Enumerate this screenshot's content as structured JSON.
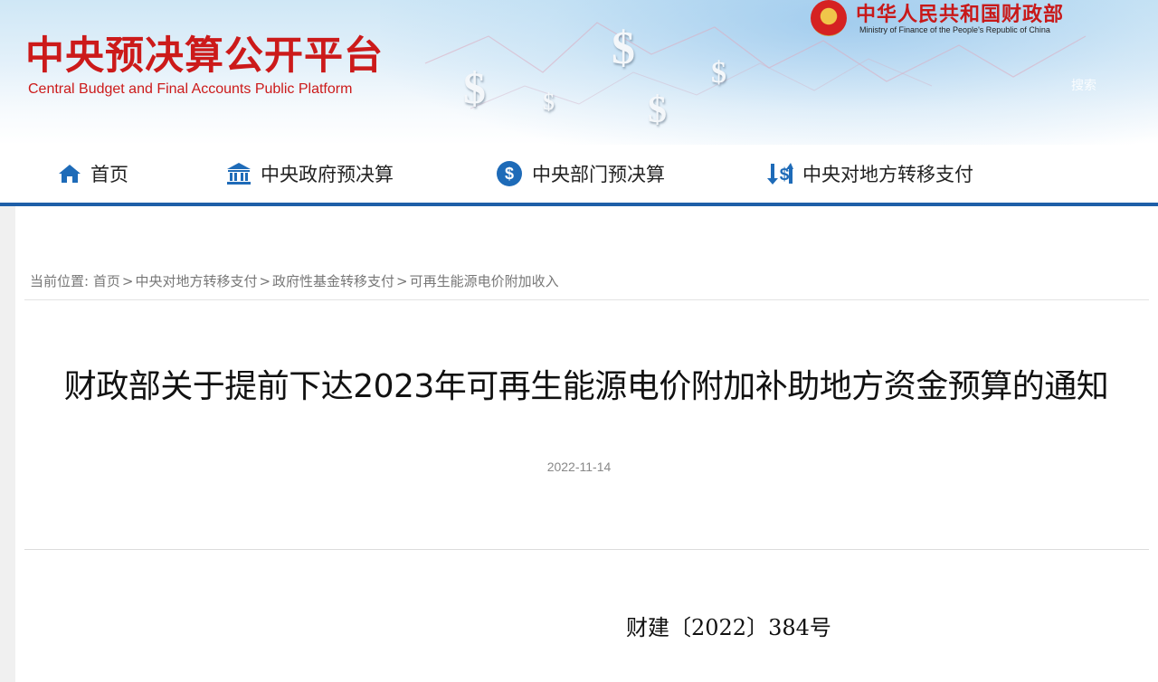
{
  "header": {
    "logo_cn": "中央预决算公开平台",
    "logo_en": "Central Budget and Final Accounts Public Platform",
    "ministry_cn": "中华人民共和国财政部",
    "ministry_en": "Ministry of Finance of the People's Republic of China",
    "search_hint": "搜索",
    "decor_symbol": "$"
  },
  "nav": {
    "items": [
      {
        "label": "首页",
        "icon": "home-icon"
      },
      {
        "label": "中央政府预决算",
        "icon": "government-building-icon"
      },
      {
        "label": "中央部门预决算",
        "icon": "dollar-circle-icon"
      },
      {
        "label": "中央对地方转移支付",
        "icon": "transfer-dollar-icon"
      }
    ]
  },
  "breadcrumb": {
    "prefix": "当前位置:",
    "items": [
      "首页",
      "中央对地方转移支付",
      "政府性基金转移支付",
      "可再生能源电价附加收入"
    ],
    "separator": ">"
  },
  "article": {
    "title": "财政部关于提前下达2023年可再生能源电价附加补助地方资金预算的通知",
    "date": "2022-11-14",
    "doc_number": "财建〔2022〕384号"
  },
  "colors": {
    "brand_red": "#cc1a1a",
    "nav_blue": "#1e5fa8",
    "icon_blue": "#1e6bb8"
  }
}
